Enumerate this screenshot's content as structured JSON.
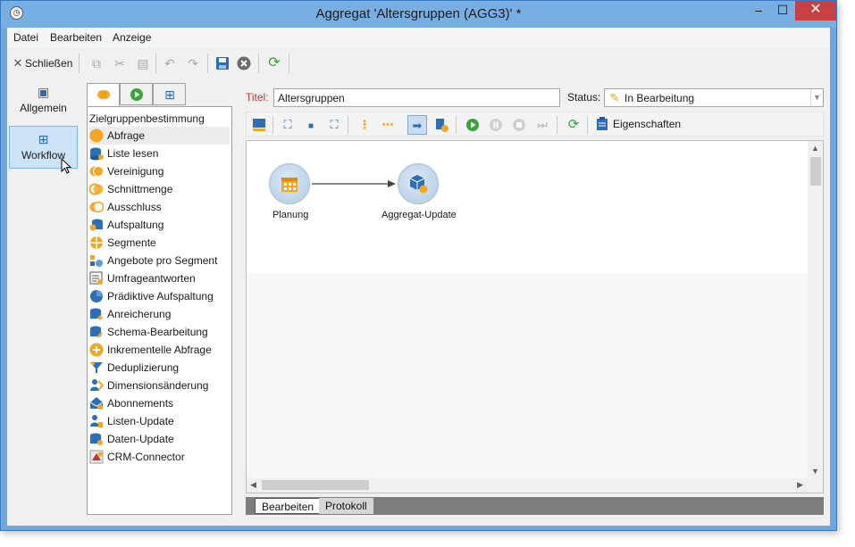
{
  "window": {
    "title": "Aggregat 'Altersgruppen (AGG3)' *",
    "app_icon": "clock-app-icon",
    "controls": {
      "minimize": "–",
      "maximize": "☐",
      "close": "✕"
    }
  },
  "menubar": {
    "items": [
      "Datei",
      "Bearbeiten",
      "Anzeige"
    ]
  },
  "toolbar": {
    "close_label": "Schließen"
  },
  "leftnav": {
    "items": [
      {
        "label": "Allgemein",
        "icon": "clipboard-icon"
      },
      {
        "label": "Workflow",
        "icon": "workflow-icon"
      }
    ]
  },
  "palette": {
    "title": "Zielgruppenbestimmung",
    "items": [
      {
        "label": "Abfrage",
        "icon": "query-icon"
      },
      {
        "label": "Liste lesen",
        "icon": "read-list-icon"
      },
      {
        "label": "Vereinigung",
        "icon": "union-icon"
      },
      {
        "label": "Schnittmenge",
        "icon": "intersection-icon"
      },
      {
        "label": "Ausschluss",
        "icon": "exclusion-icon"
      },
      {
        "label": "Aufspaltung",
        "icon": "split-icon"
      },
      {
        "label": "Segmente",
        "icon": "segments-icon"
      },
      {
        "label": "Angebote pro Segment",
        "icon": "offers-icon"
      },
      {
        "label": "Umfrageantworten",
        "icon": "survey-icon"
      },
      {
        "label": "Prädiktive Aufspaltung",
        "icon": "predictive-icon"
      },
      {
        "label": "Anreicherung",
        "icon": "enrichment-icon"
      },
      {
        "label": "Schema-Bearbeitung",
        "icon": "schema-icon"
      },
      {
        "label": "Inkrementelle Abfrage",
        "icon": "incremental-icon"
      },
      {
        "label": "Deduplizierung",
        "icon": "dedup-icon"
      },
      {
        "label": "Dimensionsänderung",
        "icon": "dimension-icon"
      },
      {
        "label": "Abonnements",
        "icon": "subscriptions-icon"
      },
      {
        "label": "Listen-Update",
        "icon": "list-update-icon"
      },
      {
        "label": "Daten-Update",
        "icon": "data-update-icon"
      },
      {
        "label": "CRM-Connector",
        "icon": "crm-icon"
      }
    ]
  },
  "form": {
    "title_label": "Titel:",
    "title_value": "Altersgruppen",
    "status_label": "Status:",
    "status_value": "In Bearbeitung"
  },
  "workflow_toolbar": {
    "properties_label": "Eigenschaften"
  },
  "canvas": {
    "nodes": [
      {
        "label": "Planung",
        "icon": "calendar-icon"
      },
      {
        "label": "Aggregat-Update",
        "icon": "cube-update-icon"
      }
    ]
  },
  "bottom_tabs": [
    "Bearbeiten",
    "Protokoll"
  ],
  "colors": {
    "titlebar": "#77afe3",
    "close_button": "#c74143",
    "title_label": "#c4352b",
    "accent": "#2e69b3"
  }
}
